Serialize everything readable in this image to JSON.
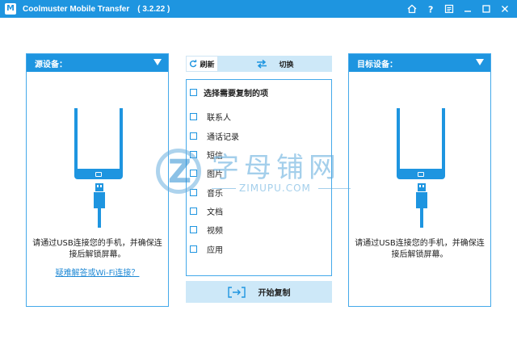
{
  "titlebar": {
    "logo": "M",
    "title": "Coolmuster Mobile Transfer",
    "version": "( 3.2.22 )",
    "icons": [
      "home-icon",
      "help-icon",
      "feedback-icon",
      "minimize-icon",
      "maximize-icon",
      "close-icon"
    ]
  },
  "source_panel": {
    "title": "源设备：",
    "message": "请通过USB连接您的手机，并确保连接后解锁屏幕。",
    "help_link": "疑难解答或Wi-Fi连接？"
  },
  "target_panel": {
    "title": "目标设备：",
    "message": "请通过USB连接您的手机，并确保连接后解锁屏幕。"
  },
  "toolbar": {
    "refresh_label": "刷新",
    "switch_label": "切换"
  },
  "content_list": {
    "header": "选择需要复制的项",
    "items": [
      "联系人",
      "通话记录",
      "短信",
      "图片",
      "音乐",
      "文档",
      "视频",
      "应用"
    ]
  },
  "start_button": {
    "label": "开始复制"
  },
  "watermark": {
    "cn": "字母铺网",
    "en": "ZIMUPU.COM"
  },
  "colors": {
    "accent": "#1e95e0",
    "light_accent": "#cde8f8",
    "link": "#1e88d4"
  }
}
